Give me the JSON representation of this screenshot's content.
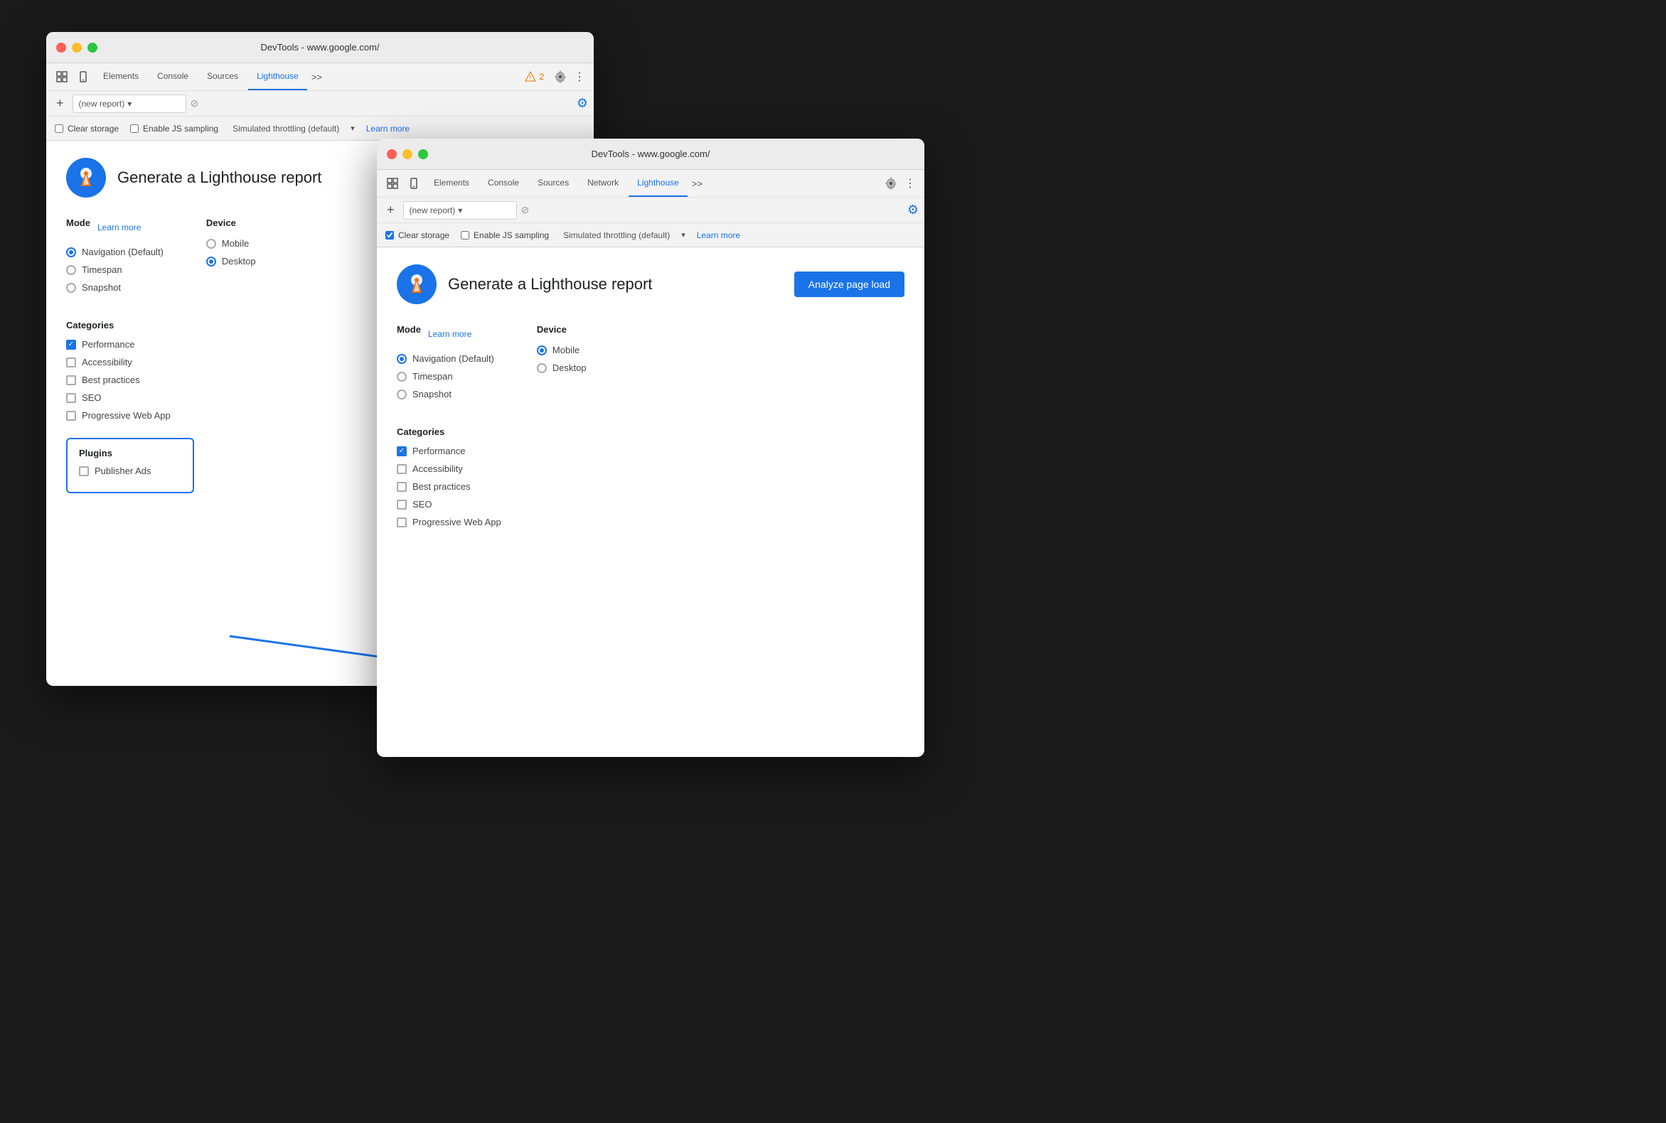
{
  "window_back": {
    "title": "DevTools - www.google.com/",
    "toolbar": {
      "tabs": [
        "Elements",
        "Console",
        "Sources",
        "Lighthouse"
      ],
      "active_tab": "Lighthouse",
      "more_label": ">>",
      "warning": "2",
      "new_report_placeholder": "(new report)",
      "throttling_text": "Simulated throttling (default)",
      "learn_more": "Learn more",
      "clear_storage": "Clear storage",
      "enable_js": "Enable JS sampling"
    },
    "main": {
      "title": "Generate a Lighthouse report",
      "mode_label": "Mode",
      "learn_more": "Learn more",
      "device_label": "Device",
      "modes": [
        "Navigation (Default)",
        "Timespan",
        "Snapshot"
      ],
      "devices": [
        "Mobile",
        "Desktop"
      ],
      "active_mode": "Navigation (Default)",
      "active_device": "Desktop",
      "categories_label": "Categories",
      "categories": [
        "Performance",
        "Accessibility",
        "Best practices",
        "SEO",
        "Progressive Web App"
      ],
      "checked_categories": [
        "Performance"
      ],
      "plugins_label": "Plugins",
      "plugins": [
        "Publisher Ads"
      ]
    }
  },
  "window_front": {
    "title": "DevTools - www.google.com/",
    "toolbar": {
      "tabs": [
        "Elements",
        "Console",
        "Sources",
        "Network",
        "Lighthouse"
      ],
      "active_tab": "Lighthouse",
      "more_label": ">>",
      "new_report_placeholder": "(new report)",
      "throttling_text": "Simulated throttling (default)",
      "learn_more": "Learn more",
      "clear_storage": "Clear storage",
      "enable_js": "Enable JS sampling"
    },
    "main": {
      "title": "Generate a Lighthouse report",
      "analyze_btn": "Analyze page load",
      "mode_label": "Mode",
      "learn_more": "Learn more",
      "device_label": "Device",
      "modes": [
        "Navigation (Default)",
        "Timespan",
        "Snapshot"
      ],
      "devices": [
        "Mobile",
        "Desktop"
      ],
      "active_mode": "Navigation (Default)",
      "active_device": "Mobile",
      "categories_label": "Categories",
      "categories": [
        "Performance",
        "Accessibility",
        "Best practices",
        "SEO",
        "Progressive Web App"
      ],
      "checked_categories": [
        "Performance"
      ]
    }
  },
  "colors": {
    "blue": "#1a73e8",
    "red": "#ff5f57",
    "yellow": "#ffbd2e",
    "green": "#28c840",
    "warning_orange": "#e37400"
  }
}
